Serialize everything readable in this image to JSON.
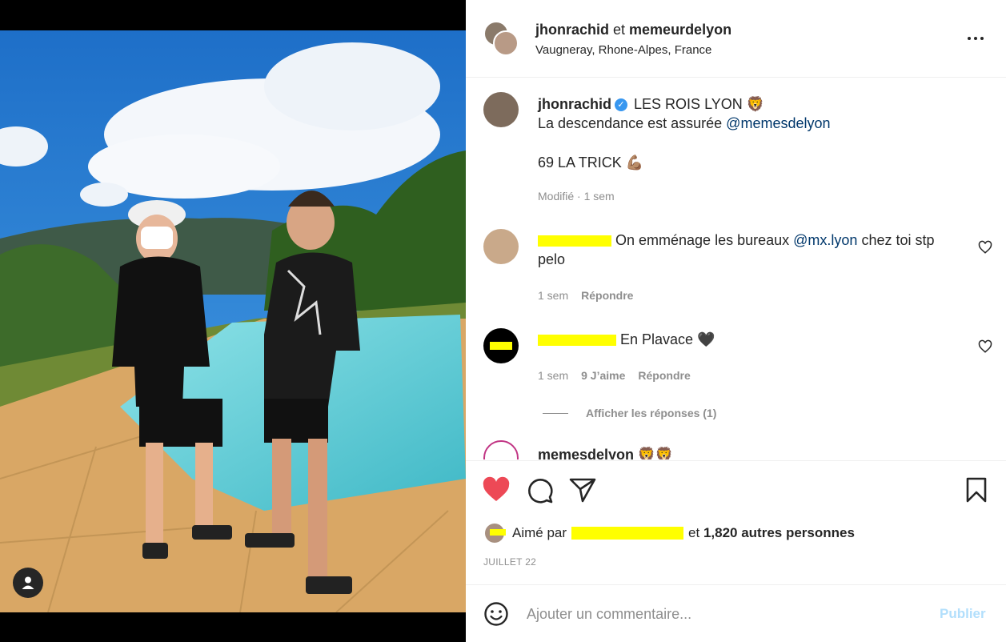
{
  "header": {
    "user1": "jhonrachid",
    "joiner": "et",
    "user2": "memeurdelyon",
    "location": "Vaugneray, Rhone-Alpes, France"
  },
  "caption": {
    "username": "jhonrachid",
    "line1": "LES ROIS LYON 🦁",
    "line2_text": "La descendance est assurée ",
    "line2_mention": "@memesdelyon",
    "line3": "69 LA TRICK 💪🏽",
    "edited": "Modifié",
    "time": "1 sem"
  },
  "comments": [
    {
      "text_before": " On emménage les bureaux ",
      "mention": "@mx.lyon",
      "text_after": " chez toi stp pelo",
      "time": "1 sem",
      "reply": "Répondre"
    },
    {
      "text": " En Plavace 🖤",
      "time": "1 sem",
      "likes": "9 J’aime",
      "reply": "Répondre",
      "show_replies": "Afficher les réponses (1)"
    },
    {
      "username": "memesdelyon",
      "emoji": "🦁🦁"
    }
  ],
  "likes": {
    "prefix": "Aimé par",
    "middle": "et",
    "count": "1,820 autres personnes"
  },
  "date": "JUILLET 22",
  "comment_box": {
    "placeholder": "Ajouter un commentaire...",
    "publish": "Publier"
  },
  "colors": {
    "like_red": "#ed4956",
    "mention_blue": "#00376b",
    "verified_blue": "#3897f0",
    "publish_disabled": "#b2dffc",
    "redaction_yellow": "#ffff00"
  },
  "icons": [
    "heart-icon",
    "comment-icon",
    "share-icon",
    "bookmark-icon",
    "emoji-icon",
    "more-icon",
    "user-tag-icon",
    "verified-icon"
  ]
}
